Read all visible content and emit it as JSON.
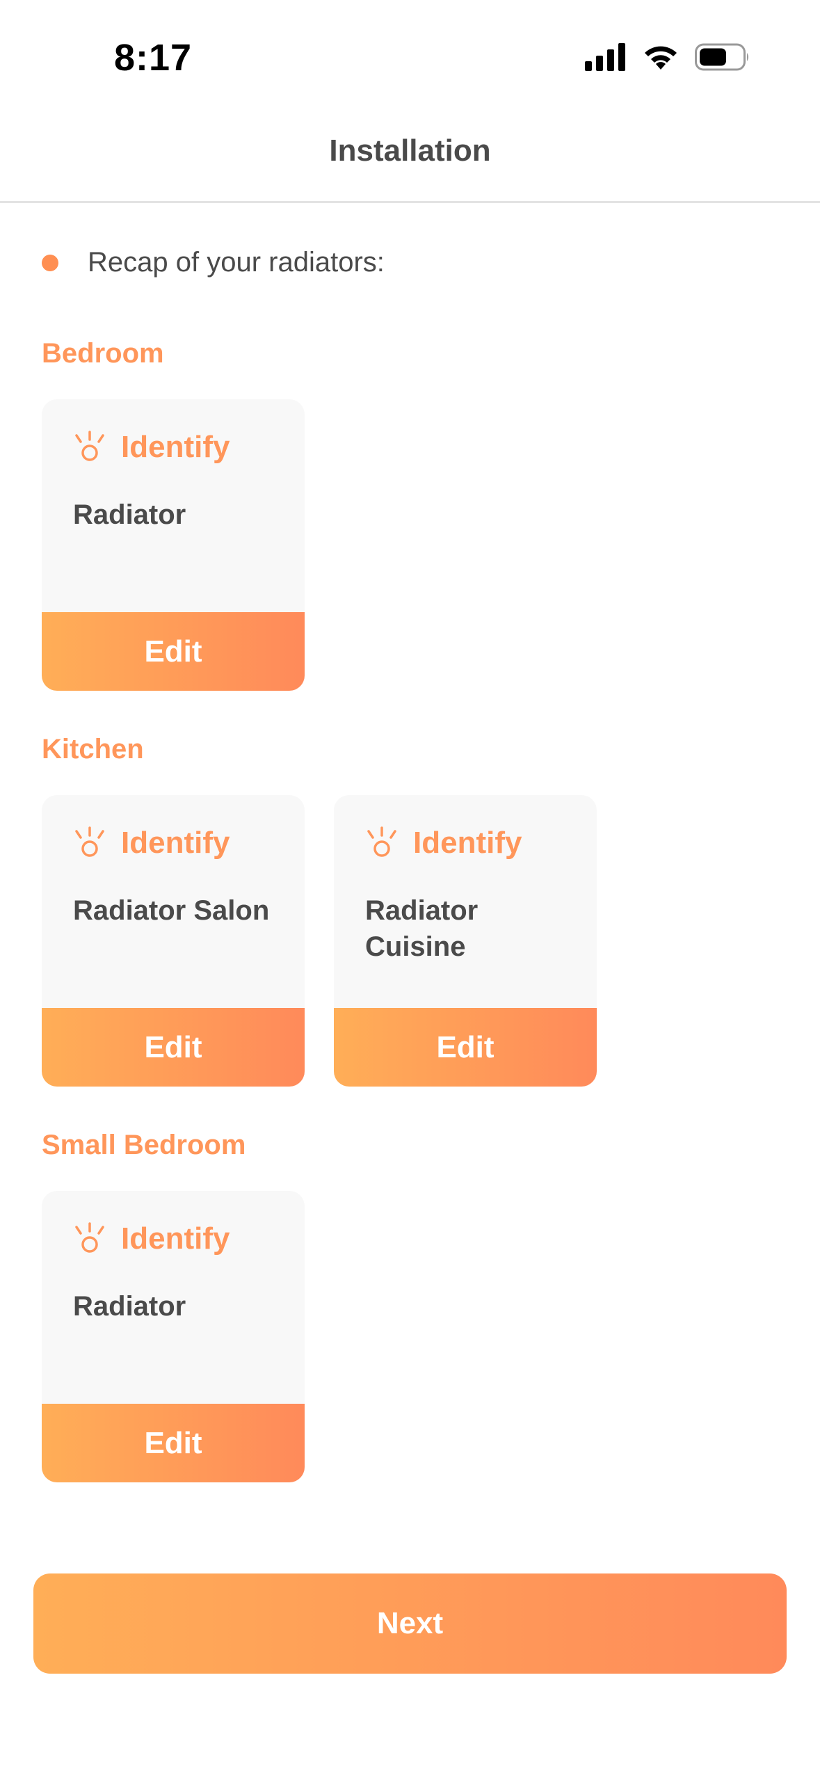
{
  "status_bar": {
    "time": "8:17",
    "icons": [
      "cellular-signal-icon",
      "wifi-icon",
      "battery-icon"
    ]
  },
  "header": {
    "title": "Installation"
  },
  "recap": {
    "text": "Recap of your radiators:"
  },
  "colors": {
    "accent": "#ff965a",
    "gradient_start": "#ffae57",
    "gradient_end": "#ff8a5a",
    "card_bg": "#f8f8f8",
    "text": "#4a4a4a"
  },
  "rooms": [
    {
      "name": "Bedroom",
      "radiators": [
        {
          "identify_label": "Identify",
          "name": "Radiator",
          "edit_label": "Edit"
        }
      ]
    },
    {
      "name": "Kitchen",
      "radiators": [
        {
          "identify_label": "Identify",
          "name": "Radiator Salon",
          "edit_label": "Edit"
        },
        {
          "identify_label": "Identify",
          "name": "Radiator Cuisine",
          "edit_label": "Edit"
        }
      ]
    },
    {
      "name": "Small Bedroom",
      "radiators": [
        {
          "identify_label": "Identify",
          "name": "Radiator",
          "edit_label": "Edit"
        }
      ]
    }
  ],
  "next_label": "Next"
}
